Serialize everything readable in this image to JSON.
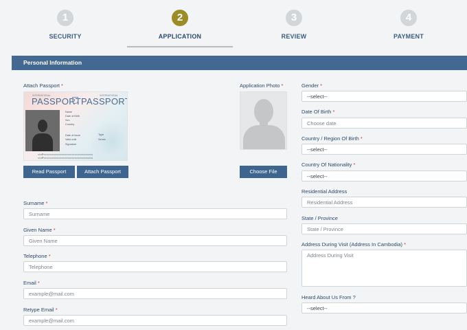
{
  "steps": [
    {
      "number": "1",
      "label": "SECURITY"
    },
    {
      "number": "2",
      "label": "APPLICATION"
    },
    {
      "number": "3",
      "label": "REVIEW"
    },
    {
      "number": "4",
      "label": "PAYMENT"
    }
  ],
  "section_title": "Personal Information",
  "passport": {
    "label": "Attach Passport",
    "card": {
      "small_left": "INTERNATIONAL",
      "small_right": "INTERNATIONAL",
      "title_left": "PASSPORT",
      "title_right": "PASSPORT",
      "fields_top": [
        "Name",
        "Date of Birth",
        "Sex",
        "Country"
      ],
      "fields_bottom": [
        "Date of issue",
        "Valid until",
        "Signature"
      ],
      "fields_right": [
        "Type",
        "Series"
      ],
      "mrz1": "<<<P<<<<<<<<<<<<<<<<<<<<<<<<<<<<<<<<<<<",
      "mrz2": "<<<P<<<<<<<<<<<<<<<<<<<<<<<<<<<<<<<<<<<"
    },
    "read_button": "Read Passport",
    "attach_button": "Attach Passport"
  },
  "photo": {
    "label": "Application Photo",
    "button": "Choose File"
  },
  "left_fields": [
    {
      "label": "Surname",
      "placeholder": "Surname"
    },
    {
      "label": "Given Name",
      "placeholder": "Given Name"
    },
    {
      "label": "Telephone",
      "placeholder": "Telephone"
    },
    {
      "label": "Email",
      "placeholder": "example@mail.com"
    },
    {
      "label": "Retype Email",
      "placeholder": "example@mail.com"
    }
  ],
  "right_fields": {
    "gender": {
      "label": "Gender",
      "value": "--select--"
    },
    "dob": {
      "label": "Date Of Birth",
      "placeholder": "Choose date"
    },
    "country_birth": {
      "label": "Country / Region Of Birth",
      "value": "--select--"
    },
    "nationality": {
      "label": "Country Of Nationality",
      "value": "--select--"
    },
    "residential": {
      "label": "Residential Address",
      "placeholder": "Residential Address"
    },
    "state": {
      "label": "State / Province",
      "placeholder": "State / Province"
    },
    "visit_address": {
      "label": "Address During Visit (Address In Cambodia)",
      "placeholder": "Address During Visit"
    },
    "heard": {
      "label": "Heard About Us From ?",
      "value": "--select--"
    }
  },
  "required_mark": "*",
  "colors": {
    "accent": "#9c8c26",
    "primary": "#436891",
    "button": "#3d6590",
    "required": "#c23a3a"
  }
}
